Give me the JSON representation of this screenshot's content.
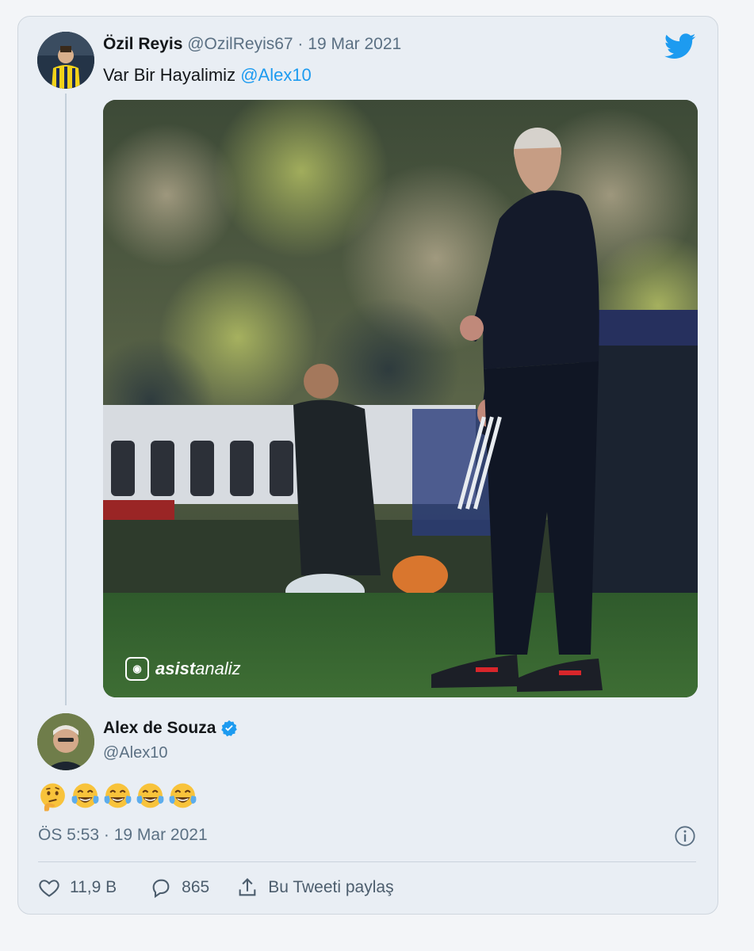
{
  "original_tweet": {
    "display_name": "Özil Reyis",
    "handle": "@OzilReyis67",
    "separator": " · ",
    "date": "19 Mar 2021",
    "text_prefix": "Var Bir Hayalimiz ",
    "mention": "@Alex10"
  },
  "media": {
    "watermark_brand_bold": "asist",
    "watermark_brand_light": "analiz",
    "icon": "camera-frame-icon"
  },
  "reply": {
    "display_name": "Alex de Souza",
    "handle": "@Alex10",
    "verified_icon": "verified-badge-icon",
    "emojis": [
      "thinking-face",
      "face-with-tears-of-joy",
      "face-with-tears-of-joy",
      "face-with-tears-of-joy",
      "face-with-tears-of-joy"
    ],
    "timestamp": "ÖS 5:53 · 19 Mar 2021"
  },
  "actions": {
    "likes": "11,9 B",
    "replies": "865",
    "share_label": "Bu Tweeti paylaş"
  },
  "colors": {
    "accent": "#1d9bf0",
    "card_bg": "#e9eef4",
    "muted_text": "#5b7083"
  }
}
